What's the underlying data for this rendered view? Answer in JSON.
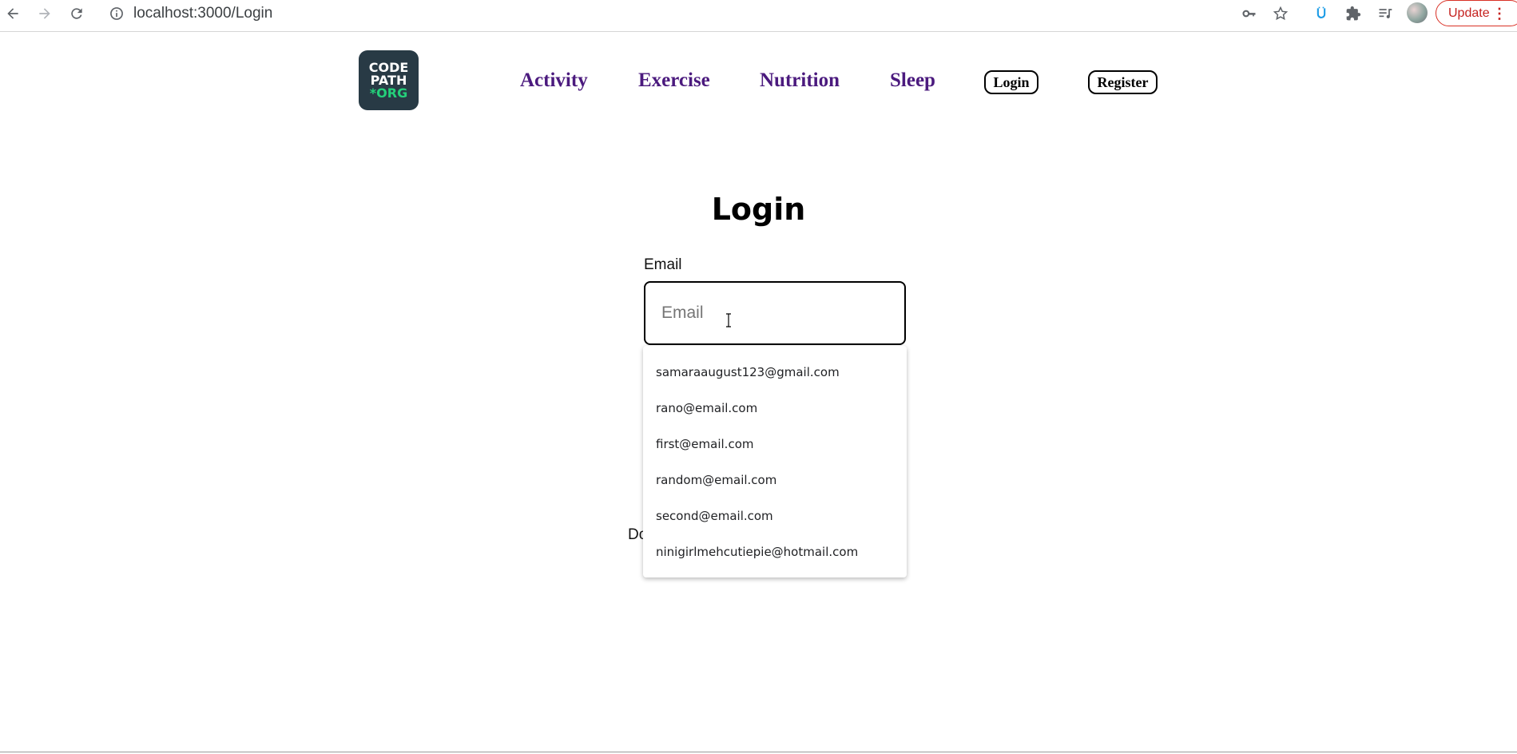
{
  "browser": {
    "url": "localhost:3000/Login",
    "update_label": "Update",
    "menu_glyph": "⋮",
    "icons": [
      "back-icon",
      "forward-icon",
      "reload-icon",
      "info-icon",
      "key-icon",
      "star-icon",
      "extension-u-icon",
      "puzzle-icon",
      "media-queue-icon",
      "profile-avatar"
    ]
  },
  "logo": {
    "line1": "CODE",
    "line2": "PATH",
    "line3": "*ORG"
  },
  "nav": {
    "activity": "Activity",
    "exercise": "Exercise",
    "nutrition": "Nutrition",
    "sleep": "Sleep",
    "login": "Login",
    "register": "Register"
  },
  "login": {
    "title": "Login",
    "email_label": "Email",
    "email_placeholder": "Email",
    "email_value": "",
    "partial_text": "Do"
  },
  "autocomplete": {
    "options": [
      "samaraaugust123@gmail.com",
      "rano@email.com",
      "first@email.com",
      "random@email.com",
      "second@email.com",
      "ninigirlmehcutiepie@hotmail.com"
    ]
  },
  "colors": {
    "nav_link": "#4b1a7e",
    "logo_bg": "#283a45",
    "logo_accent": "#24d07a",
    "update_red": "#c5221f"
  }
}
